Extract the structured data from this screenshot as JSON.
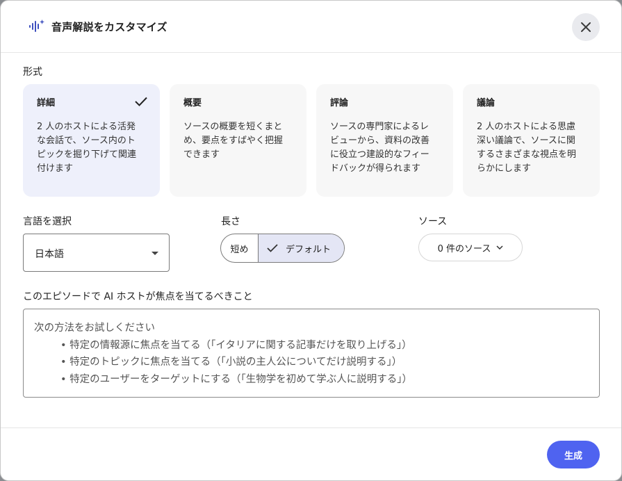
{
  "header": {
    "title": "音声解説をカスタマイズ",
    "icon": "audio-sparkle-icon",
    "close_icon": "close-icon"
  },
  "format": {
    "label": "形式",
    "cards": [
      {
        "title": "詳細",
        "desc": [
          "2 人のホストによる活発",
          "な会話で、ソース内のト",
          "ピックを掘り下げて関連",
          "付けます"
        ],
        "selected": true
      },
      {
        "title": "概要",
        "desc": [
          "ソースの概要を短くまと",
          "め、要点をすばやく把握",
          "できます"
        ],
        "selected": false
      },
      {
        "title": "評論",
        "desc": [
          "ソースの専門家によるレ",
          "ビューから、資料の改善",
          "に役立つ建設的なフィー",
          "ドバックが得られます"
        ],
        "selected": false
      },
      {
        "title": "議論",
        "desc": [
          "2 人のホストによる思慮",
          "深い議論で、ソースに関",
          "するさまざまな視点を明",
          "らかにします"
        ],
        "selected": false
      }
    ]
  },
  "language": {
    "label": "言語を選択",
    "value": "日本語"
  },
  "length": {
    "label": "長さ",
    "short": "短め",
    "default": "デフォルト",
    "selected": "default"
  },
  "source": {
    "label": "ソース",
    "value": "0 件のソース"
  },
  "focus": {
    "label": "このエピソードで AI ホストが焦点を当てるべきこと",
    "placeholder_lines": [
      "次の方法をお試しください",
      "• 特定の情報源に焦点を当てる（「イタリアに関する記事だけを取り上げる」）",
      "• 特定のトピックに焦点を当てる（「小説の主人公についてだけ説明する」）",
      "• 特定のユーザーをターゲットにする（「生物学を初めて学ぶ人に説明する」）"
    ]
  },
  "footer": {
    "generate_label": "生成"
  },
  "colors": {
    "accent": "#4f63f0",
    "selected_card": "#eef0fb",
    "card": "#f7f7f7"
  }
}
